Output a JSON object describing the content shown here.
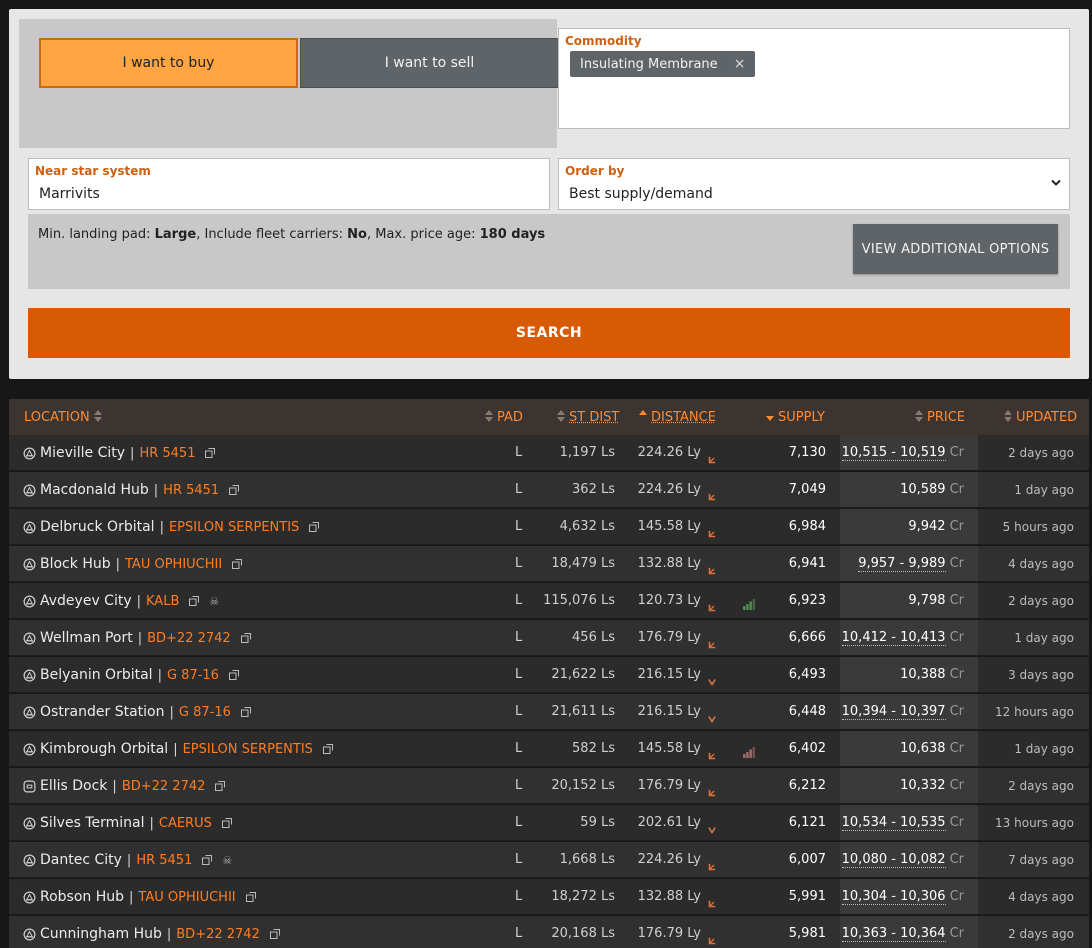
{
  "form": {
    "buy_label": "I want to buy",
    "sell_label": "I want to sell",
    "commodity_label": "Commodity",
    "commodity_tag": "Insulating Membrane",
    "commodity_tag_remove": "×",
    "near_label": "Near star system",
    "near_value": "Marrivits",
    "order_label": "Order by",
    "order_value": "Best supply/demand",
    "options_prefix_1": "Min. landing pad: ",
    "options_pad": "Large",
    "options_prefix_2": ", Include fleet carriers: ",
    "options_fleet": "No",
    "options_prefix_3": ", Max. price age: ",
    "options_age": "180 days",
    "view_options_label": "VIEW ADDITIONAL OPTIONS",
    "search_label": "SEARCH"
  },
  "columns": {
    "location": "LOCATION",
    "pad": "PAD",
    "st_dist": "ST DIST",
    "distance": "DISTANCE",
    "supply": "SUPPLY",
    "price": "PRICE",
    "updated": "UPDATED"
  },
  "colors": {
    "accent": "#ff7d20",
    "search": "#d75a06",
    "buy": "#ffa544"
  },
  "rows": [
    {
      "station": "Mieville City",
      "system": "HR 5451",
      "icon": "planetary-port-icon",
      "extra": "",
      "pad": "L",
      "st_dist": "1,197 Ls",
      "distance": "224.26 Ly",
      "trend": "up",
      "bars": "",
      "supply": "7,130",
      "price": "10,515 - 10,519",
      "range": true,
      "updated": "2 days ago"
    },
    {
      "station": "Macdonald Hub",
      "system": "HR 5451",
      "icon": "planetary-port-icon",
      "extra": "",
      "pad": "L",
      "st_dist": "362 Ls",
      "distance": "224.26 Ly",
      "trend": "up",
      "bars": "",
      "supply": "7,049",
      "price": "10,589",
      "range": false,
      "updated": "1 day ago"
    },
    {
      "station": "Delbruck Orbital",
      "system": "EPSILON SERPENTIS",
      "icon": "planetary-port-icon",
      "extra": "",
      "pad": "L",
      "st_dist": "4,632 Ls",
      "distance": "145.58 Ly",
      "trend": "up",
      "bars": "",
      "supply": "6,984",
      "price": "9,942",
      "range": false,
      "updated": "5 hours ago"
    },
    {
      "station": "Block Hub",
      "system": "TAU OPHIUCHII",
      "icon": "planetary-port-icon",
      "extra": "",
      "pad": "L",
      "st_dist": "18,479 Ls",
      "distance": "132.88 Ly",
      "trend": "up",
      "bars": "",
      "supply": "6,941",
      "price": "9,957 - 9,989",
      "range": true,
      "updated": "4 days ago"
    },
    {
      "station": "Avdeyev City",
      "system": "KALB",
      "icon": "planetary-port-icon",
      "extra": "skull",
      "pad": "L",
      "st_dist": "115,076 Ls",
      "distance": "120.73 Ly",
      "trend": "up",
      "bars": "green",
      "supply": "6,923",
      "price": "9,798",
      "range": false,
      "updated": "2 days ago"
    },
    {
      "station": "Wellman Port",
      "system": "BD+22 2742",
      "icon": "planetary-port-icon",
      "extra": "",
      "pad": "L",
      "st_dist": "456 Ls",
      "distance": "176.79 Ly",
      "trend": "up",
      "bars": "",
      "supply": "6,666",
      "price": "10,412 - 10,413",
      "range": true,
      "updated": "1 day ago"
    },
    {
      "station": "Belyanin Orbital",
      "system": "G 87-16",
      "icon": "planetary-port-icon",
      "extra": "",
      "pad": "L",
      "st_dist": "21,622 Ls",
      "distance": "216.15 Ly",
      "trend": "down",
      "bars": "",
      "supply": "6,493",
      "price": "10,388",
      "range": false,
      "updated": "3 days ago"
    },
    {
      "station": "Ostrander Station",
      "system": "G 87-16",
      "icon": "planetary-port-icon",
      "extra": "",
      "pad": "L",
      "st_dist": "21,611 Ls",
      "distance": "216.15 Ly",
      "trend": "down",
      "bars": "",
      "supply": "6,448",
      "price": "10,394 - 10,397",
      "range": true,
      "updated": "12 hours ago"
    },
    {
      "station": "Kimbrough Orbital",
      "system": "EPSILON SERPENTIS",
      "icon": "planetary-port-icon",
      "extra": "",
      "pad": "L",
      "st_dist": "582 Ls",
      "distance": "145.58 Ly",
      "trend": "up",
      "bars": "red",
      "supply": "6,402",
      "price": "10,638",
      "range": false,
      "updated": "1 day ago"
    },
    {
      "station": "Ellis Dock",
      "system": "BD+22 2742",
      "icon": "coriolis-station-icon",
      "extra": "",
      "pad": "L",
      "st_dist": "20,152 Ls",
      "distance": "176.79 Ly",
      "trend": "up",
      "bars": "",
      "supply": "6,212",
      "price": "10,332",
      "range": false,
      "updated": "2 days ago"
    },
    {
      "station": "Silves Terminal",
      "system": "CAERUS",
      "icon": "planetary-port-icon",
      "extra": "",
      "pad": "L",
      "st_dist": "59 Ls",
      "distance": "202.61 Ly",
      "trend": "down",
      "bars": "",
      "supply": "6,121",
      "price": "10,534 - 10,535",
      "range": true,
      "updated": "13 hours ago"
    },
    {
      "station": "Dantec City",
      "system": "HR 5451",
      "icon": "planetary-port-icon",
      "extra": "skull",
      "pad": "L",
      "st_dist": "1,668 Ls",
      "distance": "224.26 Ly",
      "trend": "up",
      "bars": "",
      "supply": "6,007",
      "price": "10,080 - 10,082",
      "range": true,
      "updated": "7 days ago"
    },
    {
      "station": "Robson Hub",
      "system": "TAU OPHIUCHII",
      "icon": "planetary-port-icon",
      "extra": "",
      "pad": "L",
      "st_dist": "18,272 Ls",
      "distance": "132.88 Ly",
      "trend": "up",
      "bars": "",
      "supply": "5,991",
      "price": "10,304 - 10,306",
      "range": true,
      "updated": "4 days ago"
    },
    {
      "station": "Cunningham Hub",
      "system": "BD+22 2742",
      "icon": "planetary-port-icon",
      "extra": "",
      "pad": "L",
      "st_dist": "20,168 Ls",
      "distance": "176.79 Ly",
      "trend": "up",
      "bars": "",
      "supply": "5,981",
      "price": "10,363 - 10,364",
      "range": true,
      "updated": "2 days ago"
    }
  ],
  "price_unit": "Cr"
}
